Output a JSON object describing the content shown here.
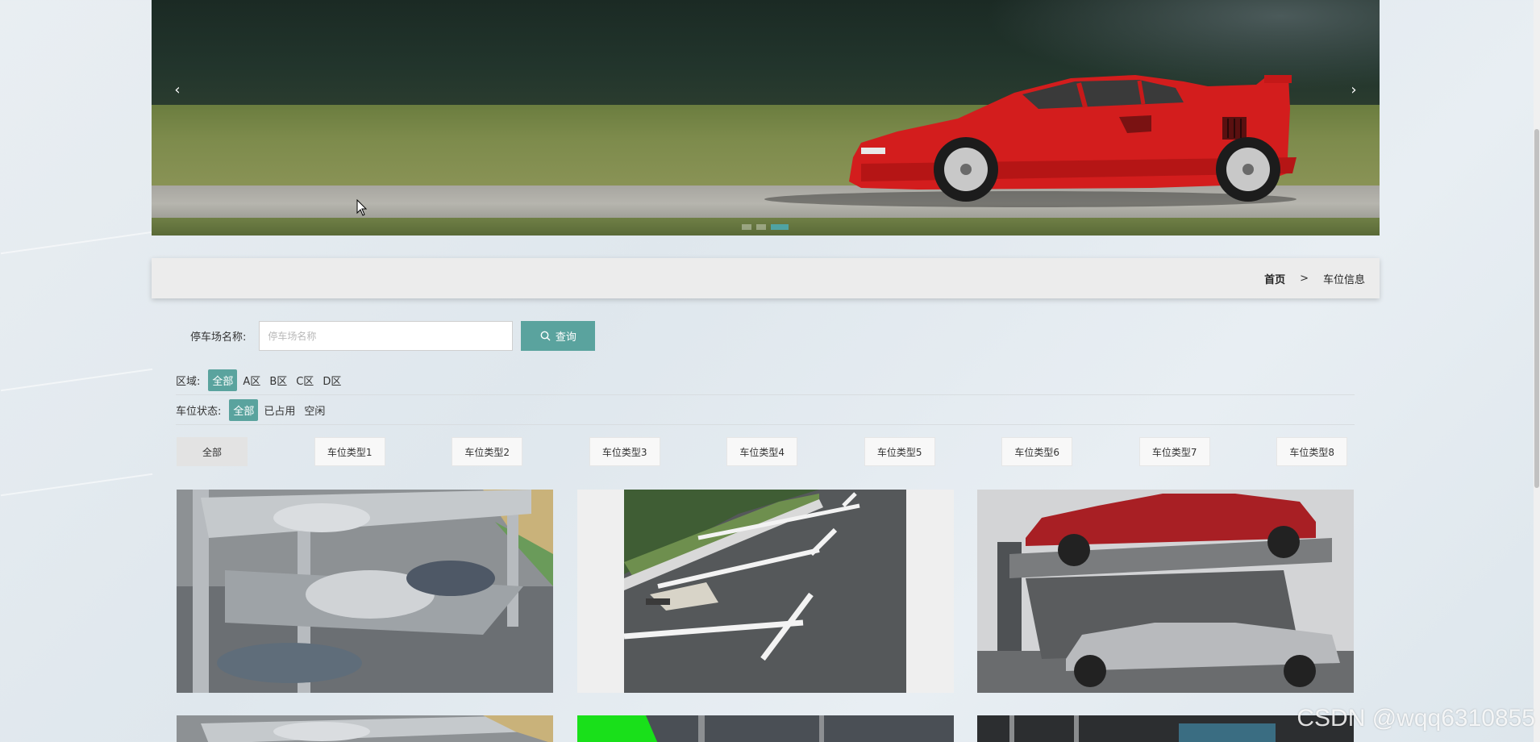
{
  "carousel": {
    "prev_icon": "chevron-left-icon",
    "next_icon": "chevron-right-icon",
    "prev_glyph": "‹",
    "next_glyph": "›",
    "slide_count": 3,
    "active_slide": 3
  },
  "breadcrumb": {
    "home": "首页",
    "separator": ">",
    "current": "车位信息"
  },
  "search": {
    "label": "停车场名称:",
    "placeholder": "停车场名称",
    "value": "",
    "button_label": "查询",
    "button_icon": "search-icon"
  },
  "area_filter": {
    "label": "区域:",
    "options": [
      "全部",
      "A区",
      "B区",
      "C区",
      "D区"
    ],
    "selected": "全部"
  },
  "status_filter": {
    "label": "车位状态:",
    "options": [
      "全部",
      "已占用",
      "空闲"
    ],
    "selected": "全部"
  },
  "categories": {
    "items": [
      "全部",
      "车位类型1",
      "车位类型2",
      "车位类型3",
      "车位类型4",
      "车位类型5",
      "车位类型6",
      "车位类型7",
      "车位类型8"
    ],
    "selected": "全部"
  },
  "cards": [
    {
      "image": "multi-level-parking-lift-image"
    },
    {
      "image": "parking-lot-markings-image"
    },
    {
      "image": "car-stacker-lift-image"
    },
    {
      "image": "multi-level-parking-lift-image"
    },
    {
      "image": "green-screen-image"
    },
    {
      "image": "parking-garage-interior-image"
    }
  ],
  "watermark": "CSDN @wqq6310855",
  "colors": {
    "accent": "#5aa39e",
    "crumb_bar_bg": "#ececec",
    "page_bg": "#e4eaef"
  }
}
